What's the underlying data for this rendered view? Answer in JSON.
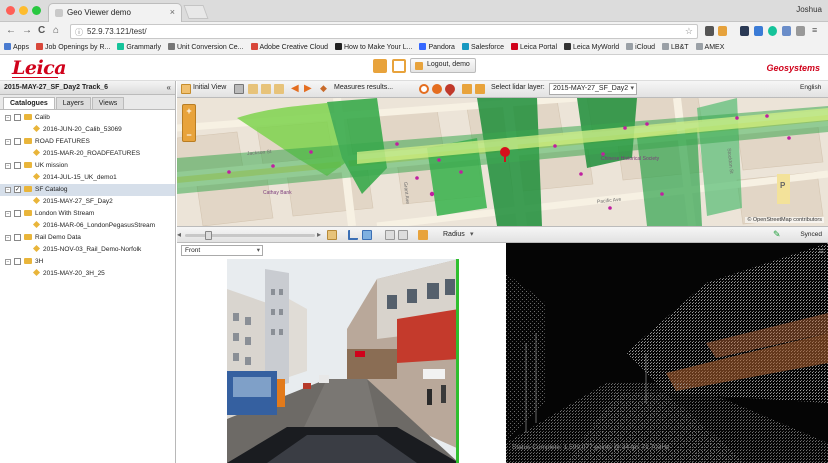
{
  "browser": {
    "tab_title": "Geo Viewer demo",
    "tab_close": "×",
    "profile": "Joshua",
    "url": "52.9.73.121/test/",
    "nav": {
      "back": "←",
      "forward": "→",
      "reload": "C",
      "home": "⌂"
    },
    "bookmarks": [
      {
        "label": "Apps",
        "color": "#4a7bd0"
      },
      {
        "label": "Job Openings by R...",
        "color": "#d8473a"
      },
      {
        "label": "Grammarly",
        "color": "#15c39a"
      },
      {
        "label": "Unit Conversion Ce...",
        "color": "#777777"
      },
      {
        "label": "Adobe Creative Cloud",
        "color": "#d8473a"
      },
      {
        "label": "How to Make Your L...",
        "color": "#222222"
      },
      {
        "label": "Pandora",
        "color": "#3668ff"
      },
      {
        "label": "Salesforce",
        "color": "#1798c1"
      },
      {
        "label": "Leica Portal",
        "color": "#d0021b"
      },
      {
        "label": "Leica MyWorld",
        "color": "#333333"
      },
      {
        "label": "iCloud",
        "color": "#9aa0a6"
      },
      {
        "label": "LB&T",
        "color": "#9aa0a6"
      },
      {
        "label": "AMEX",
        "color": "#9aa0a6"
      }
    ]
  },
  "header": {
    "logo": "Leica",
    "logout_label": "Logout, demo",
    "brand_right": "Geosystems"
  },
  "left_panel": {
    "title": "2015-MAY-27_SF_Day2 Track_6",
    "collapse_icon": "«",
    "tabs": [
      "Catalogues",
      "Layers",
      "Views"
    ],
    "tree": [
      {
        "type": "top",
        "label": "Calib",
        "checked": false
      },
      {
        "type": "child",
        "label": "2016-JUN-20_Calib_53069"
      },
      {
        "type": "top",
        "label": "ROAD FEATURES",
        "checked": false
      },
      {
        "type": "child",
        "label": "2015-MAR-20_ROADFEATURES"
      },
      {
        "type": "top",
        "label": "UK mission",
        "checked": false
      },
      {
        "type": "child",
        "label": "2014-JUL-15_UK_demo1"
      },
      {
        "type": "top",
        "label": "SF Catalog",
        "checked": true,
        "selected": true
      },
      {
        "type": "child",
        "label": "2015-MAY-27_SF_Day2"
      },
      {
        "type": "top",
        "label": "London With Stream",
        "checked": false
      },
      {
        "type": "child",
        "label": "2016-MAR-06_LondonPegasusStream"
      },
      {
        "type": "top",
        "label": "Rail Demo Data",
        "checked": false
      },
      {
        "type": "child",
        "label": "2015-NOV-03_Rail_Demo-Norfolk"
      },
      {
        "type": "top",
        "label": "3H",
        "checked": false
      },
      {
        "type": "child",
        "label": "2015-MAY-20_3H_25"
      }
    ]
  },
  "toolbar": {
    "initial_view": "Initial View",
    "measures": "Measures results...",
    "lidar_label": "Select lidar layer:",
    "lidar_value": "2015-MAY-27_SF_Day2",
    "language": "English"
  },
  "map": {
    "zoom_in": "+",
    "zoom_out": "−",
    "attribution": "© OpenStreetMap contributors",
    "parking": "P",
    "streets": [
      "Jackson St",
      "Grant Ave",
      "Stockton St",
      "Pacific Ave"
    ],
    "places": [
      "Cathay Bank",
      "Chinese Historical Society"
    ]
  },
  "view_controls": {
    "radius_label": "Radius",
    "synced_label": "Synced"
  },
  "image_view": {
    "view_select": "Front"
  },
  "pointcloud": {
    "status": "Status Complete: 1,599,077 points @ 34 fps 71.703Hz",
    "menu_icon": "≡"
  },
  "colors": {
    "accent": "#d0021b",
    "orange": "#e8a33c",
    "lidar_green": "#1f9e3a",
    "lidar_light": "#8fd35a"
  }
}
